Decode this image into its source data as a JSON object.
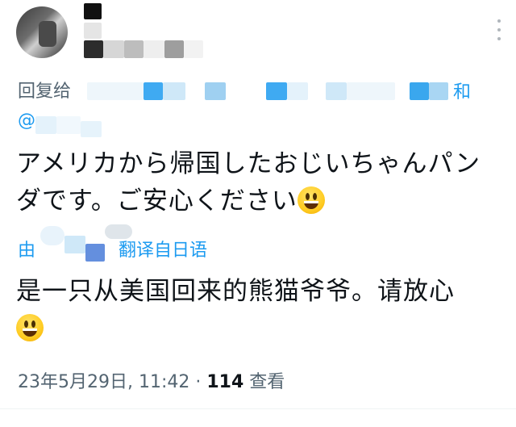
{
  "reply": {
    "prefix": "回复给",
    "suffix": "和",
    "at": "@"
  },
  "tweet": {
    "text": "アメリカから帰国したおじいちゃんパンダです。ご安心ください",
    "emoji": "grinning-face-emoji"
  },
  "translation": {
    "prefix": "由",
    "label": "翻译自日语",
    "text": "是一只从美国回来的熊猫爷爷。请放心",
    "emoji": "grinning-face-emoji"
  },
  "meta": {
    "timestamp": "23年5月29日, 11:42 · ",
    "view_count": "114",
    "views_label": " 查看"
  },
  "colors": {
    "link": "#1d9bf0",
    "muted": "#536471",
    "text": "#0f1419"
  }
}
